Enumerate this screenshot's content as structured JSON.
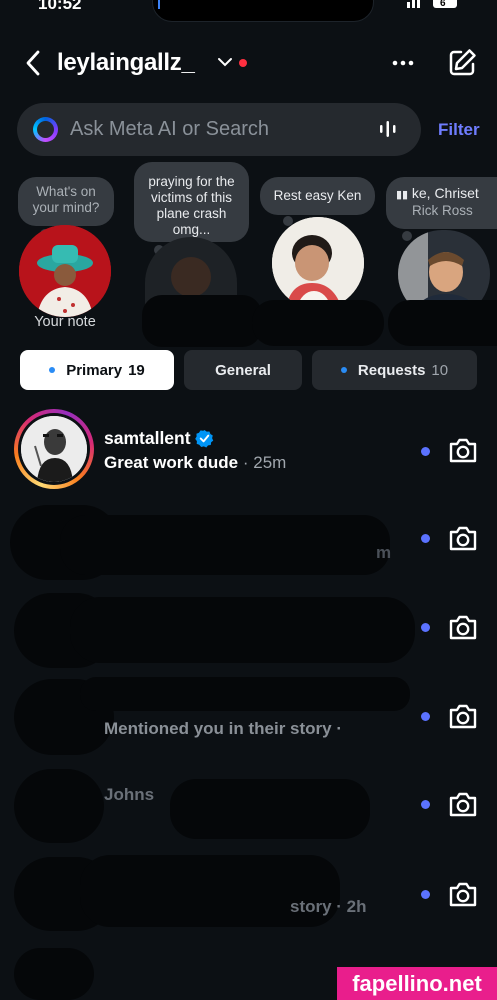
{
  "status_bar": {
    "time": "10:52",
    "right": "l l l"
  },
  "header": {
    "username": "leylaingallz_"
  },
  "search": {
    "placeholder": "Ask Meta AI or Search",
    "filter_label": "Filter"
  },
  "notes": [
    {
      "bubble": "What's on your mind?",
      "label": "Your note"
    },
    {
      "bubble": "praying for the victims of this plane crash omg...",
      "label": ""
    },
    {
      "bubble": "Rest easy Ken",
      "label": ""
    },
    {
      "bubble": "ke, Chriset",
      "bubble_sub": "Rick Ross",
      "label": ""
    }
  ],
  "tabs": [
    {
      "label": "Primary",
      "count": "19"
    },
    {
      "label": "General",
      "count": ""
    },
    {
      "label": "Requests",
      "count": "10"
    }
  ],
  "threads": [
    {
      "name": "samtallent",
      "preview": "Great work dude",
      "time": "· 25m"
    }
  ],
  "redacted_fragments": {
    "row3": "m",
    "row5": "Mentioned you in their story ·",
    "row6": "Johns",
    "row7": "story · 2h"
  },
  "watermark": "fapellino.net",
  "colors": {
    "background": "#0c1014",
    "accent": "#6f7dff",
    "unread": "#5b72ff",
    "badge_red": "#ff3040"
  }
}
